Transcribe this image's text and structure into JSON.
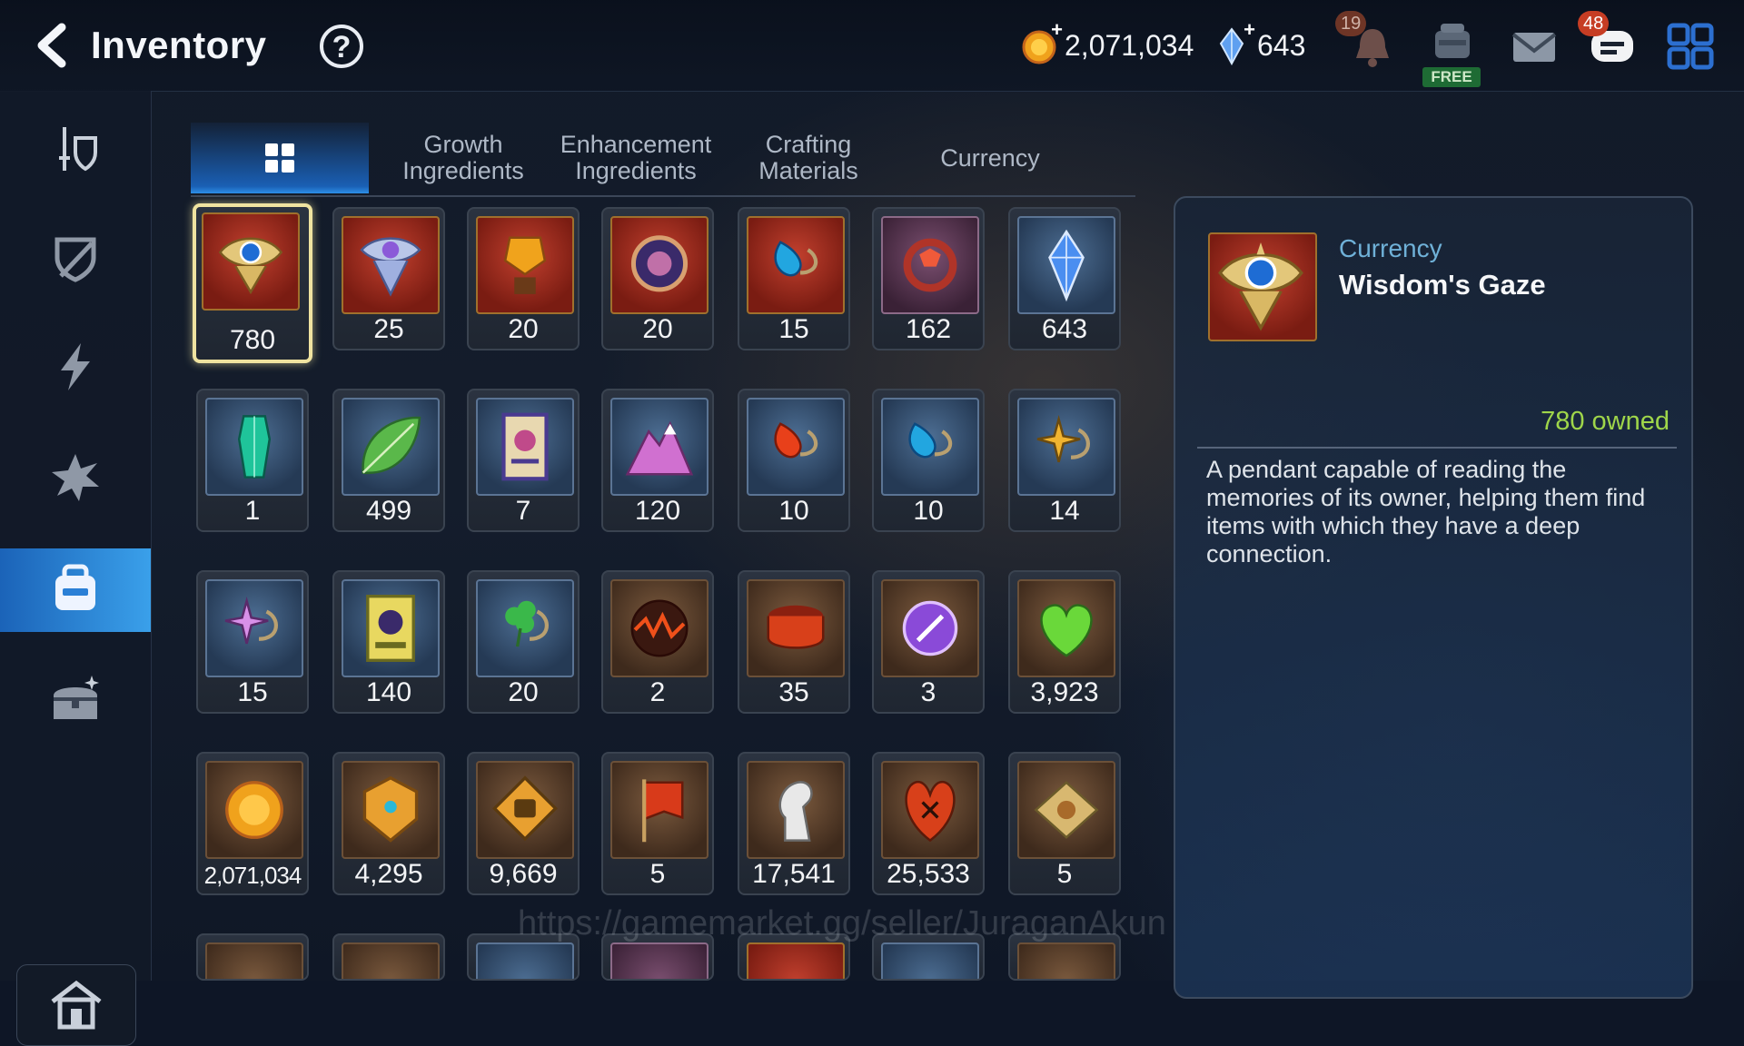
{
  "header": {
    "title": "Inventory",
    "help_label": "?"
  },
  "resources": {
    "gold": "2,071,034",
    "gems": "643"
  },
  "notifications": {
    "bell_count": "19",
    "free_label": "FREE",
    "chat_count": "48"
  },
  "tabs": [
    {
      "label": "",
      "icon": "grid-icon",
      "active": true
    },
    {
      "label": "Growth\nIngredients"
    },
    {
      "label": "Enhancement\nIngredients"
    },
    {
      "label": "Crafting\nMaterials"
    },
    {
      "label": "Currency"
    }
  ],
  "sidebar": [
    "sword-shield-icon",
    "shield-broken-icon",
    "lightning-icon",
    "star-burst-icon",
    "inventory-bag-icon",
    "treasure-chest-icon",
    "home-icon"
  ],
  "items": [
    {
      "qty": "780",
      "icon": "wisdoms-gaze-eye-icon",
      "frame": "red",
      "selected": true
    },
    {
      "qty": "25",
      "icon": "eye-pendant-icon",
      "frame": "red"
    },
    {
      "qty": "20",
      "icon": "golden-crest-icon",
      "frame": "red"
    },
    {
      "qty": "20",
      "icon": "round-shield-icon",
      "frame": "red"
    },
    {
      "qty": "15",
      "icon": "blue-charm-icon",
      "frame": "red"
    },
    {
      "qty": "162",
      "icon": "red-ring-icon",
      "frame": "purple"
    },
    {
      "qty": "643",
      "icon": "skystone-crystal-icon",
      "frame": "blue"
    },
    {
      "qty": "1",
      "icon": "green-crystal-icon",
      "frame": "blue"
    },
    {
      "qty": "499",
      "icon": "leaf-icon",
      "frame": "blue"
    },
    {
      "qty": "7",
      "icon": "scroll-card-icon",
      "frame": "blue"
    },
    {
      "qty": "120",
      "icon": "pink-mountain-icon",
      "frame": "blue"
    },
    {
      "qty": "10",
      "icon": "flame-charm-icon",
      "frame": "blue"
    },
    {
      "qty": "10",
      "icon": "water-charm-icon",
      "frame": "blue"
    },
    {
      "qty": "14",
      "icon": "star-charm-icon",
      "frame": "blue"
    },
    {
      "qty": "15",
      "icon": "moon-star-charm-icon",
      "frame": "blue"
    },
    {
      "qty": "140",
      "icon": "summon-card-icon",
      "frame": "blue"
    },
    {
      "qty": "20",
      "icon": "clover-charm-icon",
      "frame": "blue"
    },
    {
      "qty": "2",
      "icon": "lava-orb-icon",
      "frame": "brown"
    },
    {
      "qty": "35",
      "icon": "red-band-icon",
      "frame": "brown"
    },
    {
      "qty": "3",
      "icon": "purple-seal-icon",
      "frame": "brown"
    },
    {
      "qty": "3,923",
      "icon": "green-heart-icon",
      "frame": "brown"
    },
    {
      "qty": "2,071,034",
      "icon": "gold-coin-icon",
      "frame": "brown",
      "small": true
    },
    {
      "qty": "4,295",
      "icon": "gold-emblem-icon",
      "frame": "brown"
    },
    {
      "qty": "9,669",
      "icon": "fist-badge-icon",
      "frame": "brown"
    },
    {
      "qty": "5",
      "icon": "banner-flag-icon",
      "frame": "brown"
    },
    {
      "qty": "17,541",
      "icon": "horse-knight-icon",
      "frame": "brown"
    },
    {
      "qty": "25,533",
      "icon": "red-leaf-crest-icon",
      "frame": "brown"
    },
    {
      "qty": "5",
      "icon": "ticket-icon",
      "frame": "brown"
    }
  ],
  "detail": {
    "category": "Currency",
    "name": "Wisdom's Gaze",
    "owned": "780 owned",
    "description": "A pendant capable of reading the memories of its owner, helping them find items with which they have a deep connection."
  },
  "watermark": "https://gamemarket.gg/seller/JuraganAkun",
  "colors": {
    "accent": "#2d8fe8",
    "owned": "#9fd64a",
    "category": "#6fb1d8",
    "badge": "#c63d24"
  }
}
